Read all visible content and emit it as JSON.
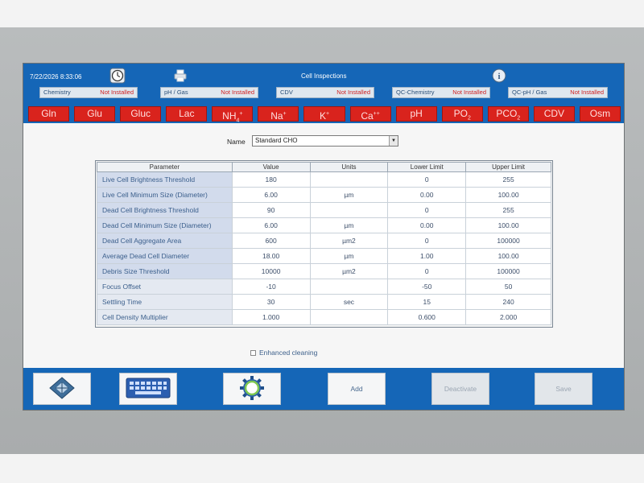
{
  "header": {
    "date_time": "7/22/2026  8:33:06",
    "title": "Cell Inspections",
    "status_boxes": [
      {
        "label": "Chemistry",
        "status": "Not Installed"
      },
      {
        "label": "pH / Gas",
        "status": "Not Installed"
      },
      {
        "label": "CDV",
        "status": "Not Installed"
      },
      {
        "label": "QC-Chemistry",
        "status": "Not Installed"
      },
      {
        "label": "QC-pH / Gas",
        "status": "Not Installed"
      }
    ]
  },
  "analytes": [
    {
      "base": "Gln",
      "sub": "",
      "sup": ""
    },
    {
      "base": "Glu",
      "sub": "",
      "sup": ""
    },
    {
      "base": "Gluc",
      "sub": "",
      "sup": ""
    },
    {
      "base": "Lac",
      "sub": "",
      "sup": ""
    },
    {
      "base": "NH",
      "sub": "4",
      "sup": "+"
    },
    {
      "base": "Na",
      "sub": "",
      "sup": "+"
    },
    {
      "base": "K",
      "sub": "",
      "sup": "+"
    },
    {
      "base": "Ca",
      "sub": "",
      "sup": "++"
    },
    {
      "base": "pH",
      "sub": "",
      "sup": ""
    },
    {
      "base": "PO",
      "sub": "2",
      "sup": ""
    },
    {
      "base": "PCO",
      "sub": "2",
      "sup": ""
    },
    {
      "base": "CDV",
      "sub": "",
      "sup": ""
    },
    {
      "base": "Osm",
      "sub": "",
      "sup": ""
    }
  ],
  "name_field": {
    "label": "Name",
    "value": "Standard CHO"
  },
  "table": {
    "headers": [
      "Parameter",
      "Value",
      "Units",
      "Lower Limit",
      "Upper Limit"
    ],
    "rows": [
      [
        "Live Cell Brightness Threshold",
        "180",
        "",
        "0",
        "255"
      ],
      [
        "Live Cell Minimum Size (Diameter)",
        "6.00",
        "µm",
        "0.00",
        "100.00"
      ],
      [
        "Dead Cell Brightness Threshold",
        "90",
        "",
        "0",
        "255"
      ],
      [
        "Dead Cell Minimum Size (Diameter)",
        "6.00",
        "µm",
        "0.00",
        "100.00"
      ],
      [
        "Dead Cell Aggregate Area",
        "600",
        "µm2",
        "0",
        "100000"
      ],
      [
        "Average Dead Cell Diameter",
        "18.00",
        "µm",
        "1.00",
        "100.00"
      ],
      [
        "Debris Size Threshold",
        "10000",
        "µm2",
        "0",
        "100000"
      ],
      [
        "Focus Offset",
        "-10",
        "",
        "-50",
        "50"
      ],
      [
        "Settling Time",
        "30",
        "sec",
        "15",
        "240"
      ],
      [
        "Cell Density Multiplier",
        "1.000",
        "",
        "0.600",
        "2.000"
      ]
    ]
  },
  "enhanced_cleaning": {
    "label": "Enhanced cleaning",
    "checked": false
  },
  "toolbar": {
    "add_label": "Add",
    "deactivate_label": "Deactivate",
    "save_label": "Save"
  },
  "icons": {
    "navigation": "navigation-diamond-icon",
    "keyboard": "keyboard-icon",
    "settings": "gear-icon",
    "clock": "clock-icon",
    "printer": "printer-icon",
    "info": "info-icon"
  },
  "colors": {
    "header_blue": "#1566b7",
    "analyte_red": "#d9231d",
    "status_red": "#d02020"
  }
}
